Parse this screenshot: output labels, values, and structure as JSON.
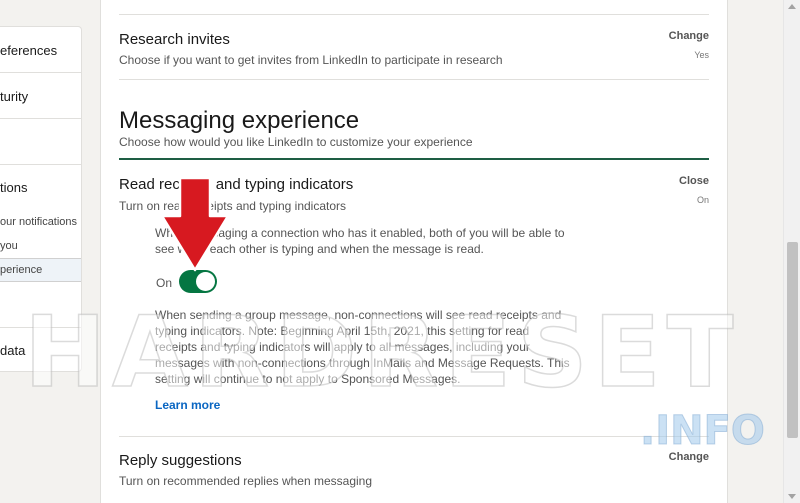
{
  "sidebar": {
    "items": [
      {
        "label": "eferences"
      },
      {
        "label": "turity"
      },
      {
        "label": "tions"
      },
      {
        "label": "our notifications"
      },
      {
        "label": "you"
      },
      {
        "label": "perience"
      },
      {
        "label": "data"
      }
    ]
  },
  "main": {
    "research_invites": {
      "title": "Research invites",
      "description": "Choose if you want to get invites from LinkedIn to participate in research",
      "action": "Change",
      "value": "Yes"
    },
    "section": {
      "title": "Messaging experience",
      "description": "Choose how would you like LinkedIn to customize your experience"
    },
    "read_receipts": {
      "title": "Read receipts and typing indicators",
      "description": "Turn on read receipts and typing indicators",
      "action": "Close",
      "value": "On",
      "para1_line1": "When messaging a connection who has it enabled, both of you will be able to",
      "para1_line2": "see when each other is typing and when the message is read.",
      "toggle_label": "On",
      "toggle_state": "on",
      "para2_lines": [
        "When sending a group message, non-connections will see read receipts and",
        "typing indicators. Note: Beginning April 15th, 2021, this setting for read",
        "receipts and typing indicators will apply to all messages, including your",
        "messages with non-connections through InMails and Message Requests. This",
        "setting will continue to not apply to Sponsored Messages."
      ],
      "learn_more": "Learn more"
    },
    "reply_suggestions": {
      "title": "Reply suggestions",
      "description": "Turn on recommended replies when messaging",
      "action": "Change"
    }
  },
  "watermark": {
    "text": "HARDRESET",
    "sub": ".INFO"
  },
  "colors": {
    "accent_green": "#057642",
    "divider_green": "#1e5e44",
    "link_blue": "#0a66c2",
    "arrow_red": "#d71920"
  },
  "icons": {
    "arrow": "red-down-arrow-icon"
  }
}
